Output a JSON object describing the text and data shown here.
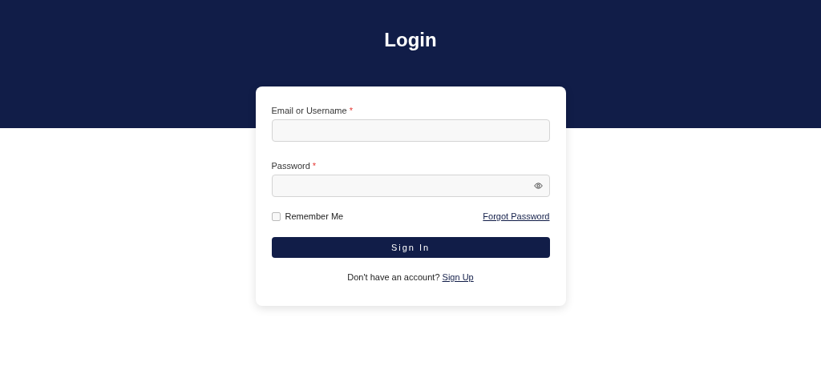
{
  "header": {
    "title": "Login"
  },
  "fields": [
    {
      "label": "Email or Username",
      "required_mark": "*",
      "kind": "text"
    },
    {
      "label": "Password",
      "required_mark": "*",
      "kind": "password"
    }
  ],
  "remember": {
    "label": "Remember Me",
    "checked": false
  },
  "forgot_link": "Forgot Password",
  "submit": "Sign In",
  "signup": {
    "prompt": "Don't have an account?",
    "link": "Sign Up"
  }
}
